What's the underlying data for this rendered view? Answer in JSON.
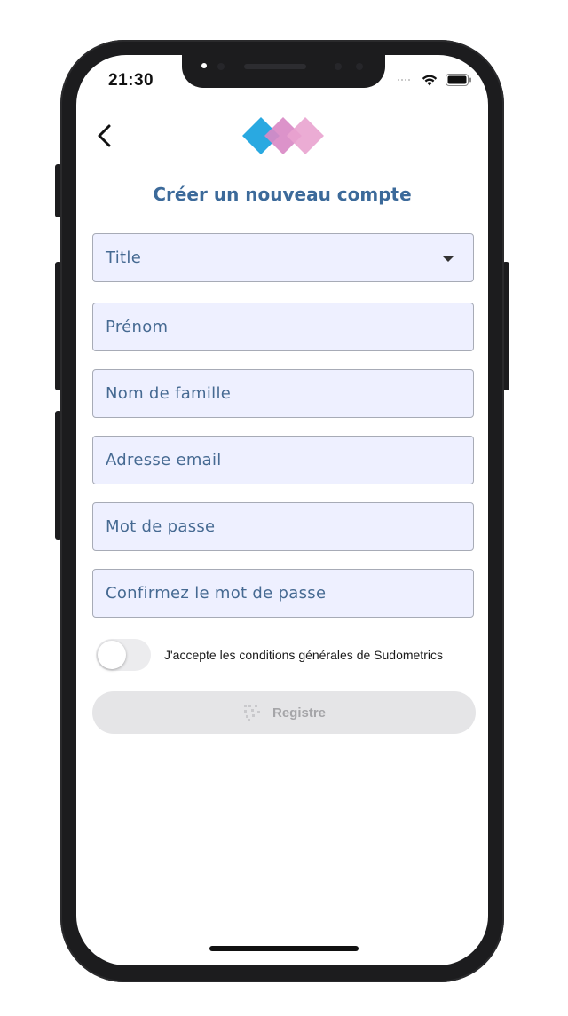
{
  "status_bar": {
    "time": "21:30",
    "icons": [
      "signal-dots-icon",
      "wifi-icon",
      "battery-icon"
    ]
  },
  "header": {
    "back_icon": "chevron-left-icon",
    "logo_colors": [
      "#29a9e1",
      "#d98ac6",
      "#e9a3cf"
    ],
    "title": "Créer un nouveau compte"
  },
  "form": {
    "title_select": {
      "placeholder": "Title",
      "icon": "caret-down-icon"
    },
    "first_name": {
      "placeholder": "Prénom"
    },
    "last_name": {
      "placeholder": "Nom de famille"
    },
    "email": {
      "placeholder": "Adresse email"
    },
    "password": {
      "placeholder": "Mot de passe"
    },
    "confirm_password": {
      "placeholder": "Confirmez le mot de passe"
    }
  },
  "terms": {
    "label": "J'accepte les conditions générales de Sudometrics",
    "accepted": false
  },
  "register": {
    "label": "Registre",
    "icon": "spinner-icon",
    "disabled": true
  },
  "colors": {
    "title": "#3c6a9a",
    "field_bg": "#eef0ff",
    "field_text": "#466a92",
    "button_disabled_bg": "#e5e5e7"
  }
}
